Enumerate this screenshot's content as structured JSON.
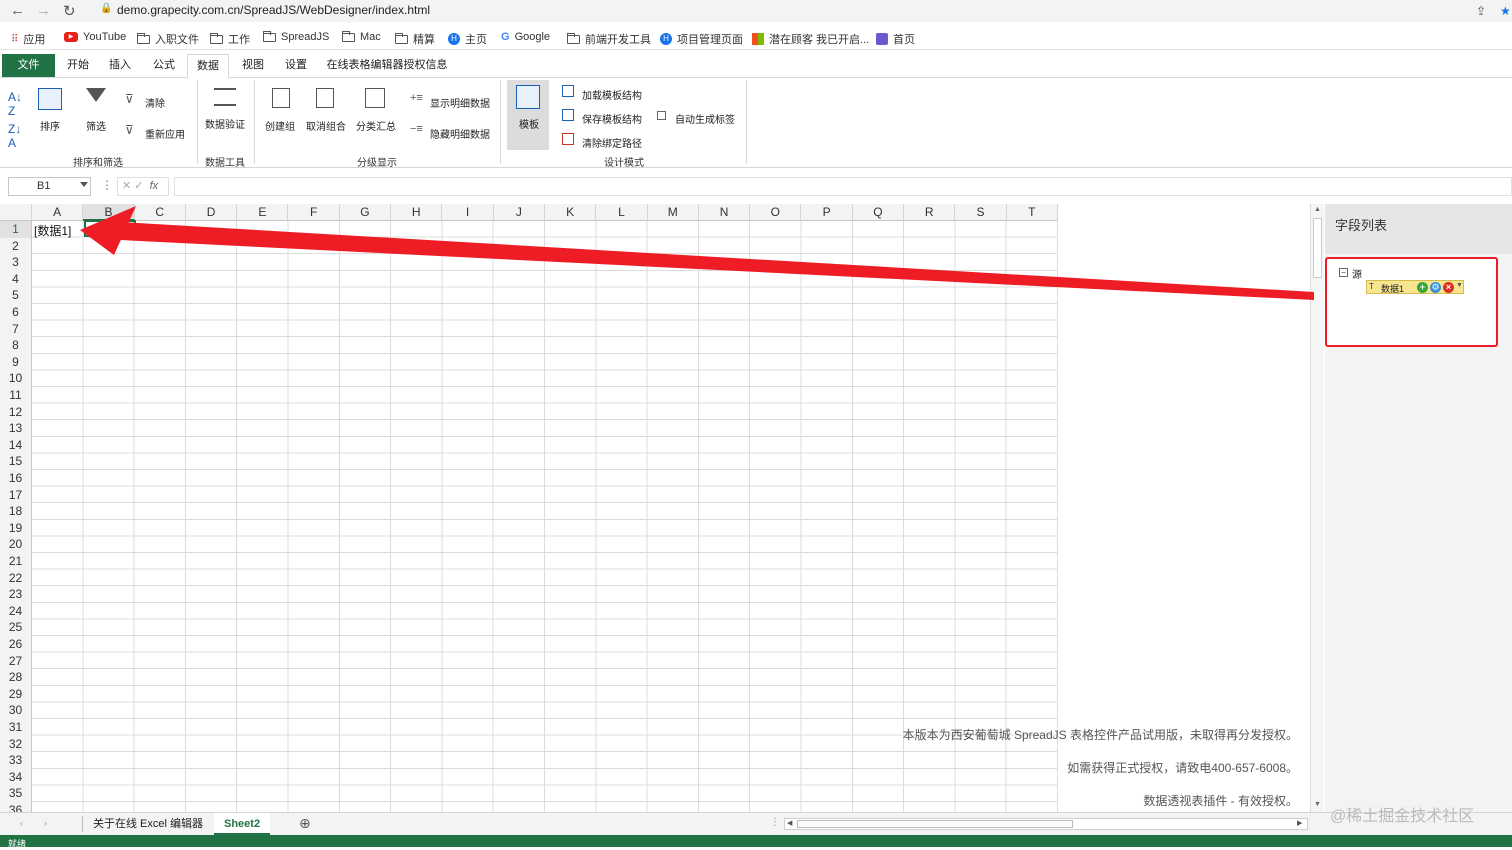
{
  "browser": {
    "url": "demo.grapecity.com.cn/SpreadJS/WebDesigner/index.html",
    "bookmarks": [
      "应用",
      "YouTube",
      "入职文件",
      "工作",
      "SpreadJS",
      "Mac",
      "精算",
      "主页",
      "Google",
      "前端开发工具",
      "项目管理页面",
      "潜在顾客 我已开启...",
      "首页"
    ]
  },
  "ribbon": {
    "tabs": [
      "文件",
      "开始",
      "插入",
      "公式",
      "数据",
      "视图",
      "设置",
      "在线表格编辑器授权信息"
    ],
    "active_tab": "数据",
    "buttons": {
      "sort": "排序",
      "filter": "筛选",
      "clear": "清除",
      "reapply": "重新应用",
      "data_validation": "数据验证",
      "group": "创建组",
      "ungroup": "取消组合",
      "subtotal": "分类汇总",
      "show_detail": "显示明细数据",
      "hide_detail": "隐藏明细数据",
      "template": "模板",
      "load_schema": "加载模板结构",
      "save_schema": "保存模板结构",
      "clear_binding": "清除绑定路径",
      "auto_label": "自动生成标签"
    },
    "groups": {
      "sort_filter": "排序和筛选",
      "data_tools": "数据工具",
      "outline": "分级显示",
      "design_mode": "设计模式"
    }
  },
  "formula_bar": {
    "name_box": "B1",
    "fx": "fx"
  },
  "sheet": {
    "columns": [
      "A",
      "B",
      "C",
      "D",
      "E",
      "F",
      "G",
      "H",
      "I",
      "J",
      "K",
      "L",
      "M",
      "N",
      "O",
      "P",
      "Q",
      "R",
      "S",
      "T"
    ],
    "selected_column": "B",
    "rows": [
      "1",
      "2",
      "3",
      "4",
      "5",
      "6",
      "7",
      "8",
      "9",
      "10",
      "11",
      "12",
      "13",
      "14",
      "15",
      "16",
      "17",
      "18",
      "19",
      "20",
      "21",
      "22",
      "23",
      "24",
      "25",
      "26",
      "27",
      "28",
      "29",
      "30",
      "31",
      "32",
      "33",
      "34",
      "35",
      "36"
    ],
    "cell_a1": "[数据1]",
    "watermark": [
      "本版本为西安葡萄城 SpreadJS 表格控件产品试用版，未取得再分发授权。",
      "如需获得正式授权，请致电400-657-6008。",
      "数据透视表插件 - 有效授权。"
    ]
  },
  "field_panel": {
    "title": "字段列表",
    "root": "源",
    "item": "数据1"
  },
  "sheet_tabs": [
    "关于在线 Excel 编辑器",
    "Sheet2"
  ],
  "active_sheet": "Sheet2",
  "status": "就绪",
  "site_watermark": "@稀土掘金技术社区",
  "colors": {
    "accent": "#217346",
    "annotation": "#ee1c24"
  }
}
